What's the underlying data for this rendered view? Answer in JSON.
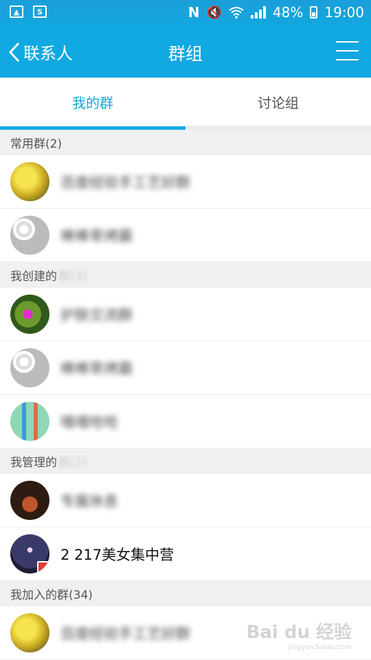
{
  "status_bar": {
    "battery": "48%",
    "time": "19:00"
  },
  "app_bar": {
    "back_label": "联系人",
    "title": "群组"
  },
  "tabs": [
    {
      "label": "我的群",
      "active": true
    },
    {
      "label": "讨论组",
      "active": false
    }
  ],
  "sections": [
    {
      "title": "常用群(2)",
      "title_hidden": "",
      "groups": [
        {
          "name": "百度经验手工艺好群",
          "avatar": "yellow-machine"
        },
        {
          "name": "棒棒草烤霸",
          "avatar": "white-balls"
        }
      ]
    },
    {
      "title": "我创建的",
      "title_hidden": "群(3)",
      "groups": [
        {
          "name": "护肤交流群",
          "avatar": "flowers"
        },
        {
          "name": "棒棒草烤霸",
          "avatar": "white-balls"
        },
        {
          "name": "嘻嘻哈哈",
          "avatar": "toothbrush"
        }
      ]
    },
    {
      "title": "我管理的",
      "title_hidden": "群(2)",
      "groups": [
        {
          "name": "专属休息",
          "avatar": "teapot"
        },
        {
          "name": "2 217美女集中营",
          "avatar": "night-star",
          "blurred": false,
          "badge": true
        }
      ]
    },
    {
      "title": "我加入的群(34)",
      "title_hidden": "",
      "groups": [
        {
          "name": "百度经验手工艺好群",
          "avatar": "yellow-machine"
        }
      ]
    }
  ],
  "watermark": {
    "logo": "Bai du 经验",
    "url": "jingyan.baidu.com"
  },
  "colors": {
    "brand": "#12a8e1",
    "section_bg": "#f0f0f2"
  }
}
